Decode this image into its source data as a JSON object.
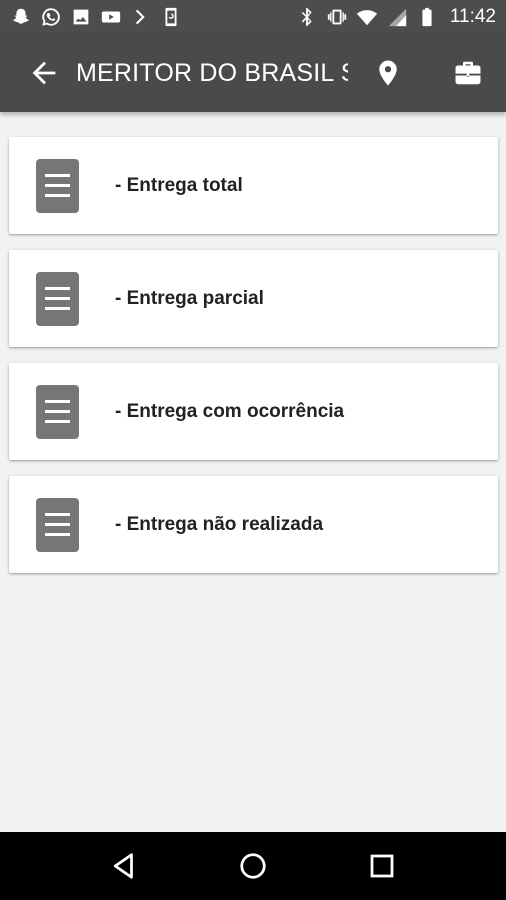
{
  "status_bar": {
    "time": "11:42",
    "left_icons": [
      "snapchat-icon",
      "whatsapp-icon",
      "gallery-icon",
      "youtube-icon",
      "chevron-right-icon",
      "phone-sync-icon"
    ],
    "right_icons": [
      "bluetooth-icon",
      "vibrate-icon",
      "wifi-icon",
      "signal-icon",
      "battery-icon"
    ]
  },
  "app_bar": {
    "title": "MERITOR DO BRASIL S...",
    "icons": [
      "back-arrow-icon",
      "location-pin-icon",
      "briefcase-icon"
    ]
  },
  "options": [
    {
      "label": "- Entrega total",
      "icon": "document-icon"
    },
    {
      "label": "- Entrega parcial",
      "icon": "document-icon"
    },
    {
      "label": "- Entrega com ocorrência",
      "icon": "document-icon"
    },
    {
      "label": "- Entrega não realizada",
      "icon": "document-icon"
    }
  ],
  "nav_bar": {
    "icons": [
      "back-triangle-icon",
      "home-circle-icon",
      "recents-square-icon"
    ]
  },
  "colors": {
    "app_bar": "#4a4a48",
    "status_bar": "#4d4d4d",
    "background": "#f2f2f2",
    "card": "#ffffff",
    "doc_icon": "#767676",
    "nav_bar": "#000000"
  }
}
